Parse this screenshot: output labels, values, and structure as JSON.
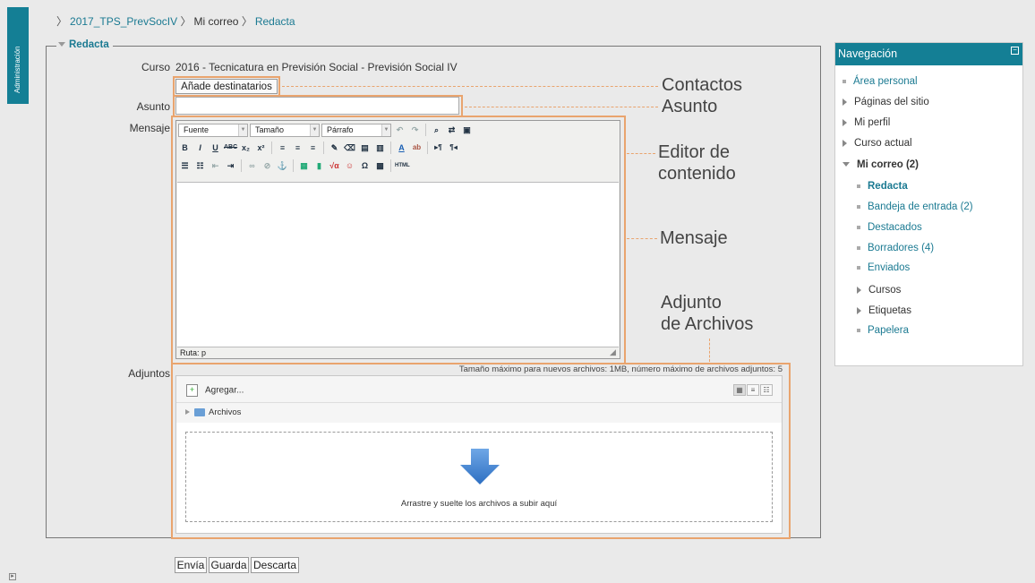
{
  "admin_tab": {
    "label": "Administración"
  },
  "breadcrumb": {
    "items": [
      {
        "label": "2017_TPS_PrevSocIV",
        "link": true
      },
      {
        "label": "Mi correo",
        "link": false
      },
      {
        "label": "Redacta",
        "link": true
      }
    ]
  },
  "form": {
    "legend": "Redacta",
    "course_label": "Curso",
    "course_value": "2016 - Tecnicatura en Previsión Social - Previsión Social IV",
    "add_recipients": "Añade destinatarios",
    "subject_label": "Asunto",
    "subject_value": "",
    "message_label": "Mensaje",
    "attachments_label": "Adjuntos"
  },
  "editor": {
    "font_select": "Fuente",
    "size_select": "Tamaño",
    "format_select": "Párrafo",
    "path": "Ruta: p"
  },
  "filemanager": {
    "limits": "Tamaño máximo para nuevos archivos: 1MB, número máximo de archivos adjuntos: 5",
    "add": "Agregar...",
    "folder": "Archivos",
    "drop_text": "Arrastre y suelte los archivos a subir aquí"
  },
  "buttons": {
    "send": "Envía",
    "save": "Guarda",
    "discard": "Descarta"
  },
  "annotations": {
    "contacts": "Contactos",
    "subject": "Asunto",
    "editor_line1": "Editor de",
    "editor_line2": "contenido",
    "message": "Mensaje",
    "attach_line1": "Adjunto",
    "attach_line2": "de Archivos"
  },
  "navigation": {
    "title": "Navegación",
    "items": [
      {
        "label": "Área personal",
        "marker": "bullet",
        "style": "link"
      },
      {
        "label": "Páginas del sitio",
        "marker": "arrow",
        "style": "plain"
      },
      {
        "label": "Mi perfil",
        "marker": "arrow",
        "style": "plain"
      },
      {
        "label": "Curso actual",
        "marker": "arrow",
        "style": "plain"
      },
      {
        "label": "Mi correo (2)",
        "marker": "arrow-down",
        "style": "plain-bold"
      },
      {
        "label": "Redacta",
        "marker": "bullet",
        "style": "link-bold"
      },
      {
        "label": "Bandeja de entrada (2)",
        "marker": "bullet",
        "style": "link"
      },
      {
        "label": "Destacados",
        "marker": "bullet",
        "style": "link"
      },
      {
        "label": "Borradores (4)",
        "marker": "bullet",
        "style": "link"
      },
      {
        "label": "Enviados",
        "marker": "bullet",
        "style": "link"
      },
      {
        "label": "Cursos",
        "marker": "arrow",
        "style": "plain"
      },
      {
        "label": "Etiquetas",
        "marker": "arrow",
        "style": "plain"
      },
      {
        "label": "Papelera",
        "marker": "bullet",
        "style": "link"
      }
    ]
  },
  "colors": {
    "accent": "#147f95",
    "link": "#1b7a92",
    "annotation": "#e9a46e"
  }
}
